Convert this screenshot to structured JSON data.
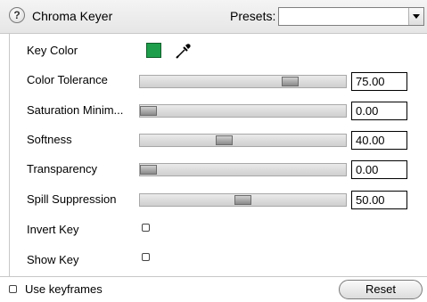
{
  "header": {
    "help_glyph": "?",
    "title": "Chroma Keyer",
    "presets_label": "Presets:",
    "presets_value": ""
  },
  "key_color": {
    "label": "Key Color",
    "swatch_color": "#1e9e4a",
    "icon": "eyedropper-icon"
  },
  "sliders": [
    {
      "label": "Color Tolerance",
      "value": "75.00",
      "fraction": 0.75
    },
    {
      "label": "Saturation Minim...",
      "value": "0.00",
      "fraction": 0.0
    },
    {
      "label": "Softness",
      "value": "40.00",
      "fraction": 0.4
    },
    {
      "label": "Transparency",
      "value": "0.00",
      "fraction": 0.0
    },
    {
      "label": "Spill Suppression",
      "value": "50.00",
      "fraction": 0.5
    }
  ],
  "checkboxes": [
    {
      "label": "Invert Key",
      "checked": false
    },
    {
      "label": "Show Key",
      "checked": false
    }
  ],
  "footer": {
    "use_keyframes_label": "Use keyframes",
    "use_keyframes_checked": false,
    "reset_label": "Reset"
  }
}
